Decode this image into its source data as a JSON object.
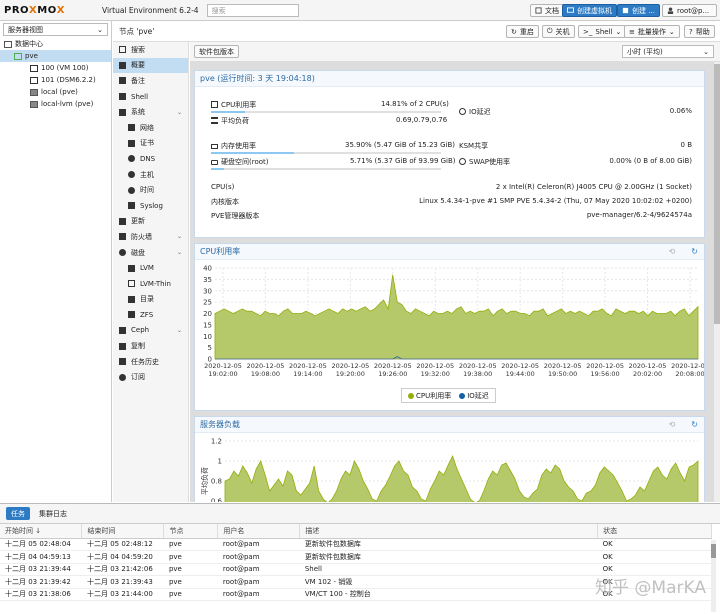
{
  "header": {
    "logo_a": "PRO",
    "logo_x1": "X",
    "logo_b": "MO",
    "logo_x2": "X",
    "version": "Virtual Environment 6.2-4",
    "search_placeholder": "搜索",
    "docs": "文档",
    "create_vm": "创建虚拟机",
    "create_ct": "创建 ...",
    "user": "root@p..."
  },
  "tree": {
    "view": "服务器视图",
    "items": [
      {
        "label": "数据中心",
        "indent": 4,
        "icon": "datacenter-icon"
      },
      {
        "label": "pve",
        "indent": 14,
        "icon": "node-icon",
        "selected": true
      },
      {
        "label": "100 (VM 100)",
        "indent": 30,
        "icon": "vm-icon"
      },
      {
        "label": "101 (DSM6.2.2)",
        "indent": 30,
        "icon": "vm-icon"
      },
      {
        "label": "local (pve)",
        "indent": 30,
        "icon": "storage-icon"
      },
      {
        "label": "local-lvm (pve)",
        "indent": 30,
        "icon": "storage-icon"
      }
    ]
  },
  "nodebar": {
    "title": "节点 'pve'",
    "restart": "重启",
    "shutdown": "关机",
    "shell": "Shell",
    "bulk": "批量操作",
    "help": "帮助"
  },
  "menu": [
    {
      "label": "搜索",
      "icon": "search-icon"
    },
    {
      "label": "概要",
      "icon": "book-icon",
      "selected": true
    },
    {
      "label": "备注",
      "icon": "notes-icon"
    },
    {
      "label": "Shell",
      "icon": "terminal-icon"
    },
    {
      "label": "系统",
      "icon": "gear-icon",
      "expand": true
    },
    {
      "label": "网络",
      "icon": "network-icon",
      "sub": true
    },
    {
      "label": "证书",
      "icon": "certificate-icon",
      "sub": true
    },
    {
      "label": "DNS",
      "icon": "globe-icon",
      "sub": true
    },
    {
      "label": "主机",
      "icon": "globe-icon",
      "sub": true
    },
    {
      "label": "时间",
      "icon": "clock-icon",
      "sub": true
    },
    {
      "label": "Syslog",
      "icon": "list-icon",
      "sub": true
    },
    {
      "label": "更新",
      "icon": "refresh-icon"
    },
    {
      "label": "防火墙",
      "icon": "shield-icon",
      "expand": true
    },
    {
      "label": "磁盘",
      "icon": "disk-icon",
      "expand": true
    },
    {
      "label": "LVM",
      "icon": "square-icon",
      "sub": true
    },
    {
      "label": "LVM-Thin",
      "icon": "square-outline-icon",
      "sub": true
    },
    {
      "label": "目录",
      "icon": "folder-icon",
      "sub": true
    },
    {
      "label": "ZFS",
      "icon": "grid-icon",
      "sub": true
    },
    {
      "label": "Ceph",
      "icon": "ceph-icon",
      "expand": true
    },
    {
      "label": "复制",
      "icon": "retweet-icon"
    },
    {
      "label": "任务历史",
      "icon": "list-icon"
    },
    {
      "label": "订阅",
      "icon": "support-icon"
    }
  ],
  "summary": {
    "package_versions": "软件包版本",
    "timeframe": "小时 (平均)",
    "title": "pve (运行时间: 3 天 19:04:18)",
    "cpu_label": "CPU利用率",
    "cpu_value": "14.81% of 2 CPU(s)",
    "cpu_pct": 0.148,
    "io_label": "IO延迟",
    "io_value": "0.06%",
    "load_label": "平均负荷",
    "load_value": "0.69,0.79,0.76",
    "mem_label": "内存使用率",
    "mem_value": "35.90% (5.47 GiB of 15.23 GiB)",
    "mem_pct": 0.359,
    "ksm_label": "KSM共享",
    "ksm_value": "0 B",
    "disk_label": "硬盘空间(root)",
    "disk_value": "5.71% (5.37 GiB of 93.99 GiB)",
    "disk_pct": 0.057,
    "swap_label": "SWAP使用率",
    "swap_value": "0.00% (0 B of 8.00 GiB)",
    "cpus_label": "CPU(s)",
    "cpus_value": "2 x Intel(R) Celeron(R) J4005 CPU @ 2.00GHz (1 Socket)",
    "kernel_label": "内核版本",
    "kernel_value": "Linux 5.4.34-1-pve #1 SMP PVE 5.4.34-2 (Thu, 07 May 2020 10:02:02 +0200)",
    "pve_label": "PVE管理器版本",
    "pve_value": "pve-manager/6.2-4/9624574a"
  },
  "cpu_chart": {
    "title": "CPU利用率",
    "legend_cpu": "CPU利用率",
    "legend_io": "IO延迟",
    "y_ticks": [
      "40",
      "35",
      "30",
      "25",
      "20",
      "15",
      "10",
      "5",
      "0"
    ],
    "x_dates": [
      "2020-12-05",
      "2020-12-05",
      "2020-12-05",
      "2020-12-05",
      "2020-12-05",
      "2020-12-05",
      "2020-12-05",
      "2020-12-05",
      "2020-12-05",
      "2020-12-05",
      "2020-12-05",
      "2020-12-05",
      "2020-12-05",
      "2020-12-05",
      "2020-12-05",
      "2020-12-05"
    ],
    "x_times": [
      "19:02:00",
      "19:08:00",
      "19:14:00",
      "19:20:00",
      "19:26:00",
      "19:32:00",
      "19:38:00",
      "19:44:00",
      "19:50:00",
      "19:56:00",
      "20:02:00",
      "20:08:00"
    ]
  },
  "load_chart": {
    "title": "服务器负载",
    "ylabel": "平均负荷",
    "y_ticks": [
      "1.2",
      "1",
      "0.8",
      "0.6"
    ]
  },
  "chart_data": [
    {
      "type": "area",
      "title": "CPU利用率",
      "ylim": [
        0,
        40
      ],
      "series": [
        {
          "name": "CPU利用率",
          "values": [
            20,
            21,
            22,
            21,
            20,
            21,
            22,
            21,
            21,
            20,
            19,
            21,
            20,
            20,
            19,
            21,
            22,
            20,
            20,
            20,
            21,
            20,
            19,
            20,
            21,
            22,
            21,
            20,
            22,
            21,
            22,
            21,
            22,
            23,
            21,
            22,
            24,
            26,
            22,
            37,
            25,
            24,
            21,
            20,
            22,
            21,
            20,
            19,
            21,
            20,
            20,
            21,
            20,
            22,
            23,
            20,
            21,
            20,
            21,
            21,
            22,
            19,
            21,
            22,
            20,
            21,
            21,
            20,
            20,
            19,
            21,
            21,
            22,
            19,
            20,
            21,
            22,
            20,
            21,
            20,
            21,
            20,
            19,
            21,
            21,
            22,
            20,
            19,
            22,
            21,
            20,
            21,
            21,
            20,
            21,
            19,
            21,
            20,
            20,
            20,
            21,
            19,
            21,
            22,
            19,
            21,
            23
          ]
        },
        {
          "name": "IO延迟",
          "values": [
            0,
            0,
            0,
            0,
            0,
            0,
            0,
            0,
            0,
            0,
            0,
            0,
            0,
            0,
            0,
            0,
            0,
            0,
            0,
            0,
            0,
            0,
            0,
            0,
            0,
            0,
            0,
            0,
            0,
            0,
            0,
            0,
            0,
            0,
            0,
            0,
            0,
            0,
            0,
            0,
            1,
            0,
            0,
            0,
            0,
            0,
            0,
            0,
            0,
            0,
            0,
            0,
            0,
            0,
            0,
            0,
            0,
            0,
            0,
            0,
            0,
            0,
            0,
            0,
            0,
            0,
            0,
            0,
            0,
            0,
            0,
            0,
            0,
            0,
            0,
            0,
            0,
            0,
            0,
            0,
            0,
            0,
            0,
            0,
            0,
            0,
            0,
            0,
            0,
            0,
            0,
            0,
            0,
            0,
            0,
            0,
            0,
            0,
            0,
            0,
            0,
            0,
            0,
            0,
            0,
            0,
            0
          ]
        }
      ]
    },
    {
      "type": "area",
      "title": "服务器负载",
      "ylabel": "平均负荷",
      "ylim": [
        0.5,
        1.2
      ],
      "series": [
        {
          "name": "平均负荷",
          "values": [
            0.8,
            0.82,
            0.9,
            0.85,
            0.95,
            0.88,
            0.78,
            0.92,
            1.0,
            0.86,
            0.7,
            0.76,
            0.82,
            0.75,
            0.9,
            0.86,
            0.7,
            0.66,
            0.72,
            0.78,
            0.95,
            0.7,
            0.62,
            0.58,
            0.62,
            0.7,
            0.82,
            0.9,
            0.86,
            1.0,
            0.92,
            0.8,
            0.72,
            0.62,
            0.6,
            0.7,
            0.76,
            0.85,
            0.95,
            1.0,
            0.9,
            0.86,
            0.74,
            0.7,
            0.62,
            0.6,
            0.72,
            0.8,
            0.9,
            0.86,
            0.96,
            1.05,
            0.92,
            0.82,
            0.72,
            0.62,
            0.58,
            0.6,
            0.7,
            0.82,
            0.9,
            0.86,
            0.96,
            0.98,
            0.9,
            0.82,
            0.7,
            0.64,
            0.62,
            0.68,
            0.72,
            0.86,
            0.92,
            0.88,
            0.96,
            0.92,
            0.8,
            0.74,
            0.7,
            0.62,
            0.6,
            0.68,
            0.7,
            0.76,
            0.88,
            0.94,
            0.9,
            0.86,
            0.78,
            0.7,
            0.6,
            0.62,
            0.66,
            0.74,
            0.7,
            0.8,
            0.9,
            0.94,
            0.86,
            0.82,
            0.92,
            0.98,
            0.88,
            0.8,
            0.94,
            0.96,
            1.0
          ]
        }
      ]
    }
  ],
  "tasks": {
    "tab_tasks": "任务",
    "tab_cluster": "集群日志",
    "columns": [
      "开始时间 ↓",
      "结束时间",
      "节点",
      "用户名",
      "描述",
      "状态"
    ],
    "rows": [
      [
        "十二月 05 02:48:04",
        "十二月 05 02:48:12",
        "pve",
        "root@pam",
        "更新软件包数据库",
        "OK"
      ],
      [
        "十二月 04 04:59:13",
        "十二月 04 04:59:20",
        "pve",
        "root@pam",
        "更新软件包数据库",
        "OK"
      ],
      [
        "十二月 03 21:39:44",
        "十二月 03 21:42:06",
        "pve",
        "root@pam",
        "Shell",
        "OK"
      ],
      [
        "十二月 03 21:39:42",
        "十二月 03 21:39:43",
        "pve",
        "root@pam",
        "VM 102 - 销毁",
        "OK"
      ],
      [
        "十二月 03 21:38:06",
        "十二月 03 21:44:00",
        "pve",
        "root@pam",
        "VM/CT 100 - 控制台",
        "OK"
      ]
    ]
  },
  "watermark": "知乎 @MarKA"
}
